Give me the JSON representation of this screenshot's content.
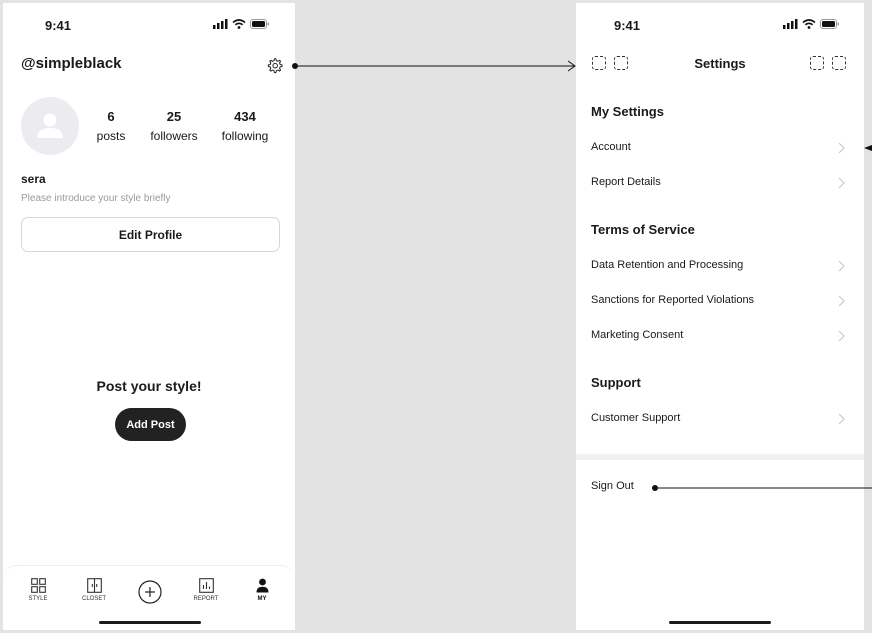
{
  "status_bar": {
    "time": "9:41"
  },
  "profile": {
    "username": "@simpleblack",
    "stats": [
      {
        "value": "6",
        "label": "posts"
      },
      {
        "value": "25",
        "label": "followers"
      },
      {
        "value": "434",
        "label": "following"
      }
    ],
    "name": "sera",
    "bio_placeholder": "Please introduce your style briefly",
    "edit_button": "Edit Profile",
    "empty_title": "Post your style!",
    "add_post_button": "Add Post"
  },
  "tab_bar": {
    "tabs": [
      {
        "label": "STYLE",
        "icon": "grid-icon"
      },
      {
        "label": "CLOSET",
        "icon": "closet-icon"
      },
      {
        "label": "",
        "icon": "plus-circle-icon"
      },
      {
        "label": "REPORT",
        "icon": "chart-icon"
      },
      {
        "label": "MY",
        "icon": "person-icon",
        "active": true
      }
    ]
  },
  "settings": {
    "title": "Settings",
    "sections": [
      {
        "title": "My Settings",
        "items": [
          "Account",
          "Report Details"
        ]
      },
      {
        "title": "Terms of Service",
        "items": [
          "Data Retention and Processing",
          "Sanctions for Reported Violations",
          "Marketing Consent"
        ]
      },
      {
        "title": "Support",
        "items": [
          "Customer Support"
        ]
      }
    ],
    "sign_out": "Sign Out"
  },
  "colors": {
    "background": "#e3e3e3",
    "screen": "#ffffff",
    "dark": "#222222",
    "muted_text": "#9a9a9a",
    "avatar_bg": "#ececf0"
  }
}
